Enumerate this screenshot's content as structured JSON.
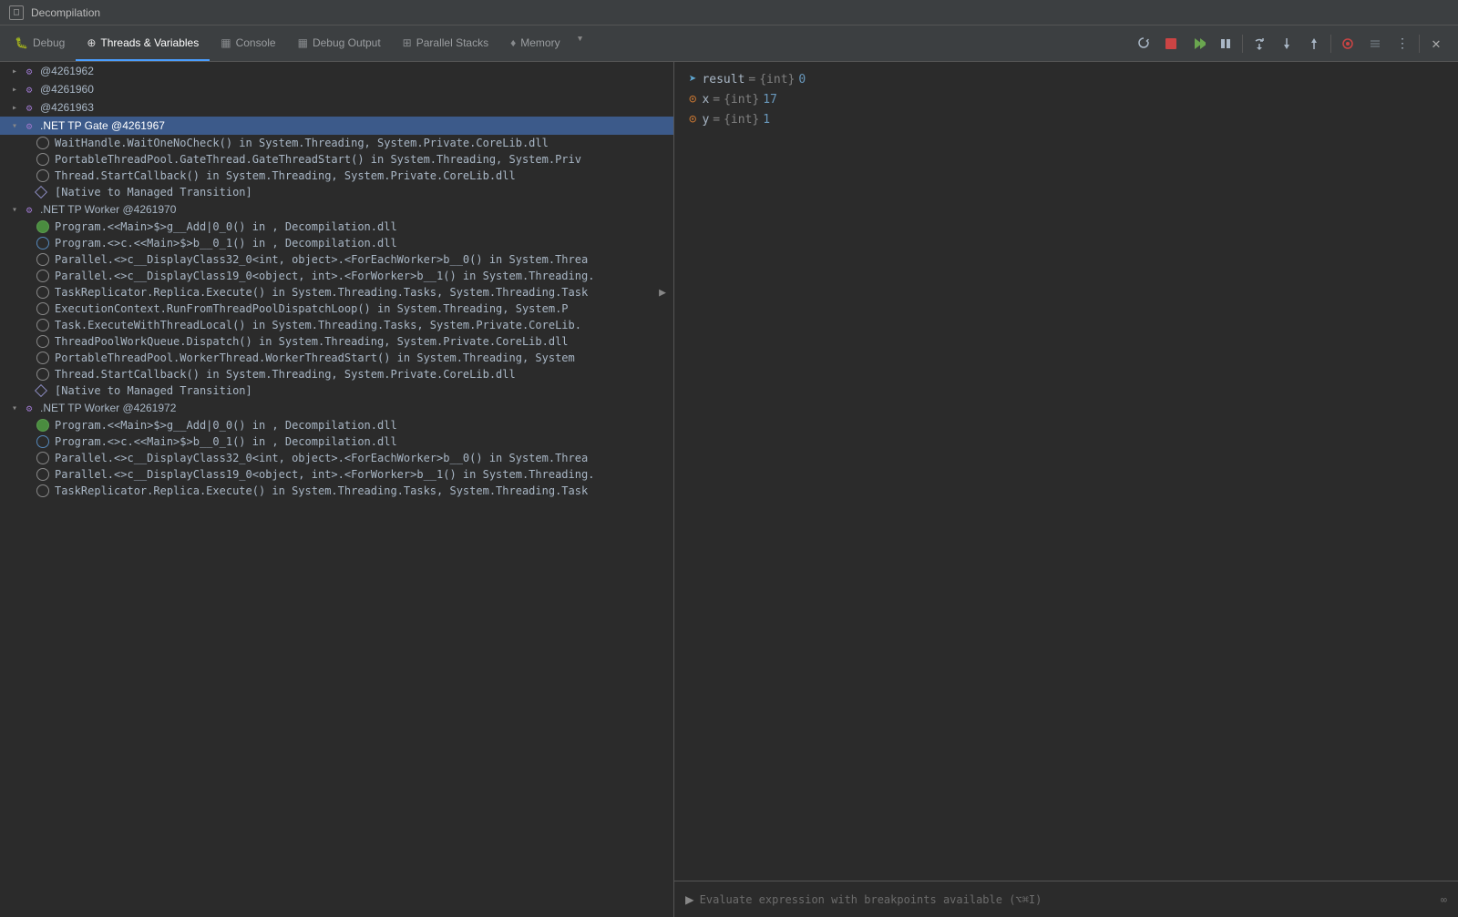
{
  "titleBar": {
    "icon": "□",
    "title": "Decompilation"
  },
  "tabs": [
    {
      "id": "debug",
      "label": "Debug",
      "icon": "🐛",
      "active": false
    },
    {
      "id": "threads",
      "label": "Threads & Variables",
      "icon": "⊕",
      "active": true
    },
    {
      "id": "console",
      "label": "Console",
      "icon": "▦",
      "active": false
    },
    {
      "id": "debug-output",
      "label": "Debug Output",
      "icon": "▦",
      "active": false
    },
    {
      "id": "parallel-stacks",
      "label": "Parallel Stacks",
      "icon": "⊞",
      "active": false
    },
    {
      "id": "memory",
      "label": "Memory",
      "icon": "♦",
      "active": false
    }
  ],
  "toolbar": {
    "buttons": [
      {
        "id": "restart",
        "icon": "↺",
        "tooltip": "Restart"
      },
      {
        "id": "stop",
        "icon": "■",
        "tooltip": "Stop",
        "color": "red"
      },
      {
        "id": "resume",
        "icon": "▶▶",
        "tooltip": "Resume",
        "color": "green"
      },
      {
        "id": "pause",
        "icon": "⏸",
        "tooltip": "Pause"
      },
      {
        "id": "step-over",
        "icon": "↷",
        "tooltip": "Step Over"
      },
      {
        "id": "step-into",
        "icon": "↓",
        "tooltip": "Step Into"
      },
      {
        "id": "step-out",
        "icon": "↑",
        "tooltip": "Step Out"
      },
      {
        "id": "run-to",
        "icon": "⊙",
        "tooltip": "Run to Cursor",
        "color": "red"
      },
      {
        "id": "force-run",
        "icon": "∅",
        "tooltip": "Force Run to Cursor"
      },
      {
        "id": "more",
        "icon": "⋮",
        "tooltip": "More"
      },
      {
        "id": "close",
        "icon": "✕",
        "tooltip": "Close"
      }
    ]
  },
  "threads": [
    {
      "id": "t1",
      "label": "@4261962",
      "expanded": false,
      "selected": false,
      "frames": []
    },
    {
      "id": "t2",
      "label": "@4261960",
      "expanded": false,
      "selected": false,
      "frames": []
    },
    {
      "id": "t3",
      "label": "@4261963",
      "expanded": false,
      "selected": false,
      "frames": []
    },
    {
      "id": "t4",
      "label": ".NET TP Gate @4261967",
      "expanded": true,
      "selected": true,
      "frames": [
        {
          "type": "gray-circle",
          "text": "WaitHandle.WaitOneNoCheck() in System.Threading, System.Private.CoreLib.dll"
        },
        {
          "type": "gray-circle",
          "text": "PortableThreadPool.GateThread.GateThreadStart() in System.Threading, System.Priv"
        },
        {
          "type": "gray-circle",
          "text": "Thread.StartCallback() in System.Threading, System.Private.CoreLib.dll"
        },
        {
          "type": "diamond",
          "text": "[Native to Managed Transition]"
        }
      ]
    },
    {
      "id": "t5",
      "label": ".NET TP Worker @4261970",
      "expanded": true,
      "selected": false,
      "frames": [
        {
          "type": "green",
          "text": "Program.<<Main>$>g__Add|0_0() in , Decompilation.dll"
        },
        {
          "type": "blue-sq",
          "text": "Program.<>c.<<Main>$>b__0_1() in , Decompilation.dll"
        },
        {
          "type": "gray-circle",
          "text": "Parallel.<>c__DisplayClass32_0<int, object>.<ForEachWorker>b__0() in System.Threa"
        },
        {
          "type": "gray-circle",
          "text": "Parallel.<>c__DisplayClass19_0<object, int>.<ForWorker>b__1() in System.Threading."
        },
        {
          "type": "gray-circle",
          "text": "TaskReplicator.Replica.Execute() in System.Threading.Tasks, System.Threading.Task ▶"
        },
        {
          "type": "gray-circle",
          "text": "ExecutionContext.RunFromThreadPoolDispatchLoop() in System.Threading, System.P"
        },
        {
          "type": "gray-circle",
          "text": "Task.ExecuteWithThreadLocal() in System.Threading.Tasks, System.Private.CoreLib."
        },
        {
          "type": "gray-circle",
          "text": "ThreadPoolWorkQueue.Dispatch() in System.Threading, System.Private.CoreLib.dll"
        },
        {
          "type": "gray-circle",
          "text": "PortableThreadPool.WorkerThread.WorkerThreadStart() in System.Threading, System"
        },
        {
          "type": "gray-circle",
          "text": "Thread.StartCallback() in System.Threading, System.Private.CoreLib.dll"
        },
        {
          "type": "diamond",
          "text": "[Native to Managed Transition]"
        }
      ]
    },
    {
      "id": "t6",
      "label": ".NET TP Worker @4261972",
      "expanded": true,
      "selected": false,
      "frames": [
        {
          "type": "green",
          "text": "Program.<<Main>$>g__Add|0_0() in , Decompilation.dll"
        },
        {
          "type": "blue-sq",
          "text": "Program.<>c.<<Main>$>b__0_1() in , Decompilation.dll"
        },
        {
          "type": "gray-circle",
          "text": "Parallel.<>c__DisplayClass32_0<int, object>.<ForEachWorker>b__0() in System.Threa"
        },
        {
          "type": "gray-circle",
          "text": "Parallel.<>c__DisplayClass19_0<object, int>.<ForWorker>b__1() in System.Threading."
        },
        {
          "type": "gray-circle",
          "text": "TaskReplicator.Replica.Execute() in System.Threading.Tasks, System.Threading.Task"
        }
      ]
    }
  ],
  "variables": [
    {
      "icon": "➤",
      "iconColor": "#5fa8d3",
      "name": "result",
      "type": "{int}",
      "value": "0"
    },
    {
      "icon": "⊙",
      "iconColor": "#cc7832",
      "name": "x",
      "type": "{int}",
      "value": "17"
    },
    {
      "icon": "⊙",
      "iconColor": "#cc7832",
      "name": "y",
      "type": "{int}",
      "value": "1"
    }
  ],
  "evalBar": {
    "placeholder": "Evaluate expression with breakpoints available (⌥⌘I)",
    "infinitySymbol": "∞"
  }
}
